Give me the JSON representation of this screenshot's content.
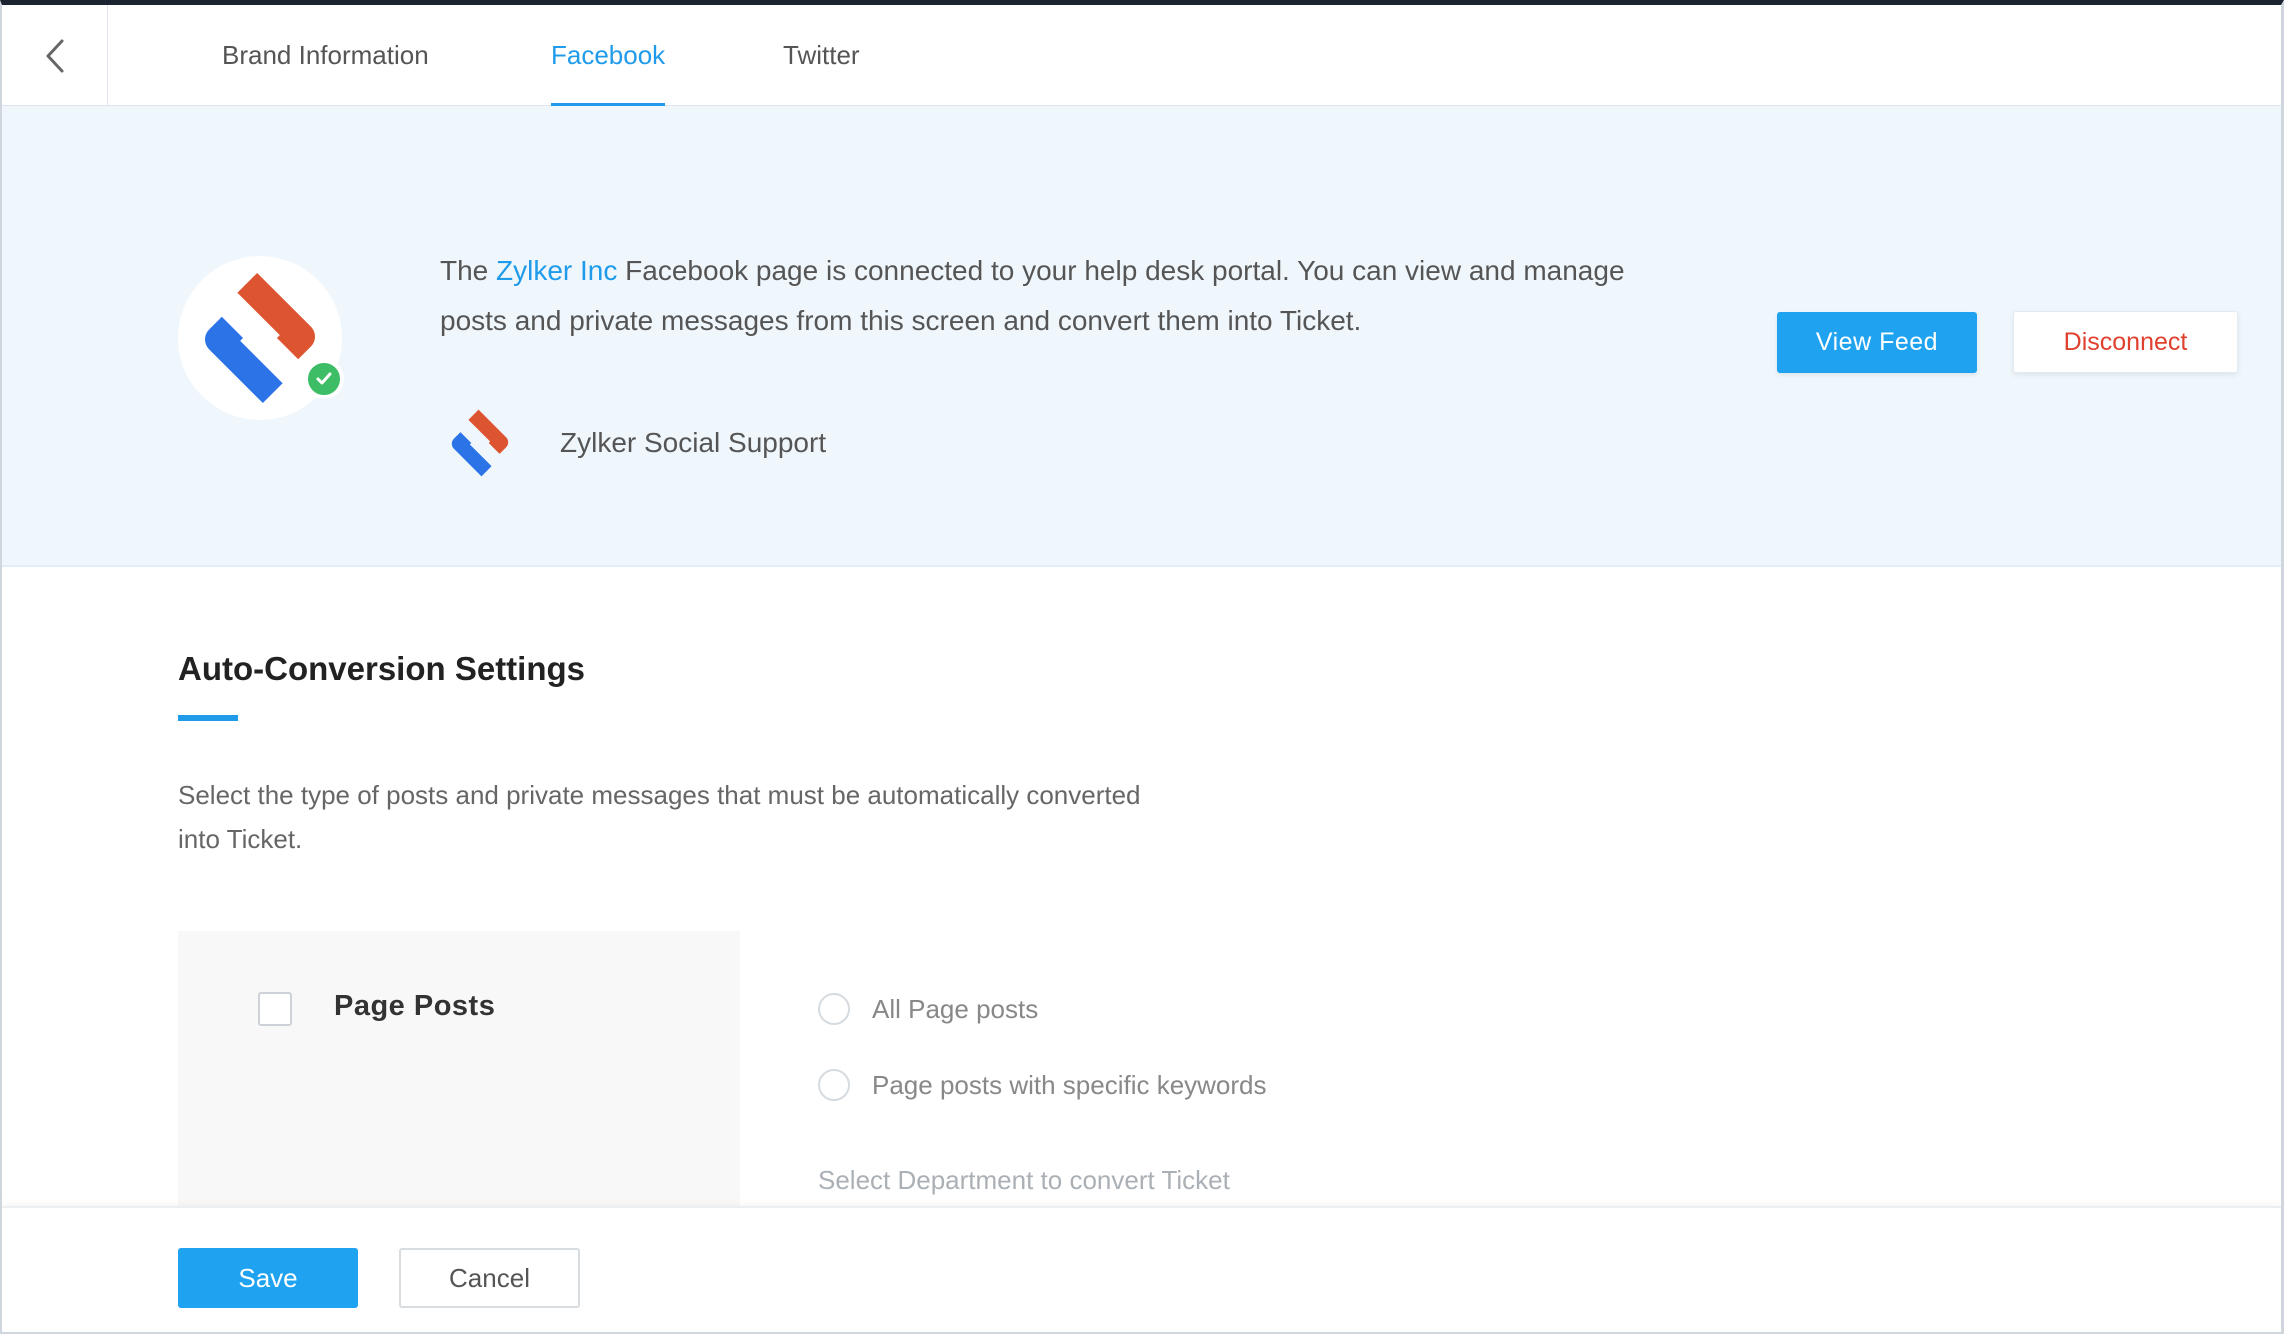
{
  "header": {
    "tabs": [
      {
        "label": "Brand Information",
        "active": false
      },
      {
        "label": "Facebook",
        "active": true
      },
      {
        "label": "Twitter",
        "active": false
      }
    ]
  },
  "banner": {
    "text_prefix": "The",
    "brand_link": "Zylker Inc",
    "text_suffix": "Facebook page is connected to your help desk portal. You can view and manage posts and private messages from this screen and convert them into Ticket.",
    "page_name": "Zylker Social Support",
    "view_feed_label": "View Feed",
    "disconnect_label": "Disconnect"
  },
  "settings": {
    "title": "Auto-Conversion Settings",
    "description": "Select the type of posts and private messages that must be automatically converted into Ticket.",
    "option_label": "Page Posts",
    "radios": [
      {
        "label": "All Page posts"
      },
      {
        "label": "Page posts with specific keywords"
      }
    ],
    "department_label": "Select Department to convert Ticket"
  },
  "footer": {
    "save_label": "Save",
    "cancel_label": "Cancel"
  },
  "colors": {
    "accent": "#1f9bea",
    "danger": "#e0412f",
    "success": "#3dbd65",
    "logo_red": "#dc5530",
    "logo_blue": "#2b73e6",
    "banner_bg": "#eff7fd"
  },
  "icons": {
    "back": "chevron-left-icon",
    "verified": "check-circle-icon",
    "logo": "zylker-logo-icon"
  }
}
